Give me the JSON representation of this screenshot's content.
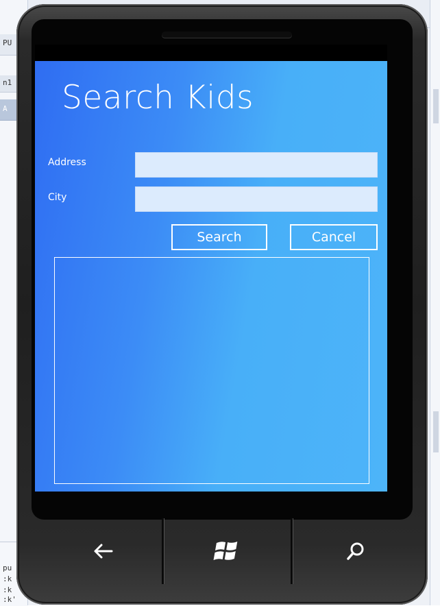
{
  "ide": {
    "top_fragment_1": "PU",
    "top_fragment_2": "n1",
    "top_fragment_3": "A",
    "bottom_fragment_1": "pu",
    "bottom_fragment_2": ":k",
    "bottom_fragment_3": ":k",
    "bottom_fragment_4": ":k'"
  },
  "app": {
    "title": "Search Kids",
    "address_label": "Address",
    "address_value": "",
    "city_label": "City",
    "city_value": "",
    "search_button": "Search",
    "cancel_button": "Cancel",
    "results": []
  },
  "hardware_buttons": {
    "back_icon": "back-arrow-icon",
    "start_icon": "windows-logo-icon",
    "search_icon": "search-magnifier-icon"
  },
  "colors": {
    "screen_gradient_start": "#2f6df2",
    "screen_gradient_end": "#4db4f9",
    "field_background": "#dcebfd",
    "phone_body": "#1f1f1f"
  }
}
